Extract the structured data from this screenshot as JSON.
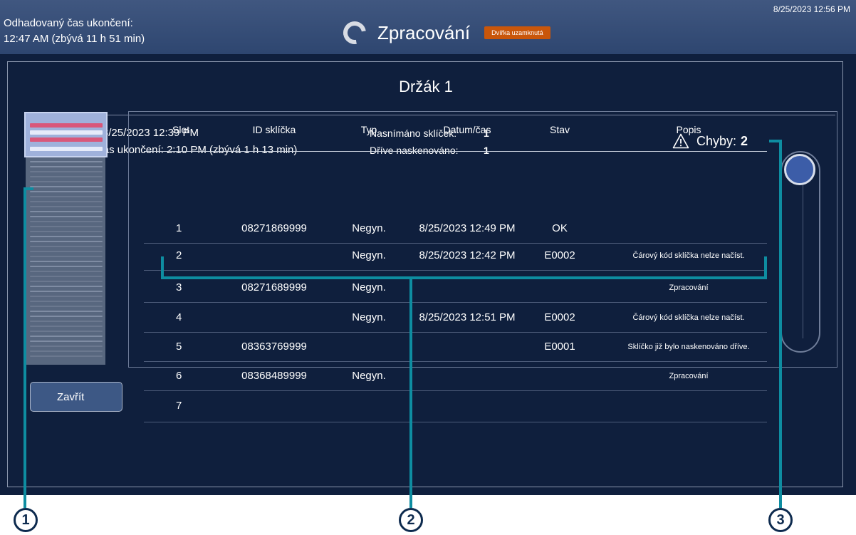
{
  "topbar": {
    "est_end_label": "Odhadovaný čas ukončení:",
    "est_end_value": "12:47 AM (zbývá 11 h 51 min)",
    "title": "Zpracování",
    "lock_badge": "Dvířka uzamknutá",
    "datetime": "8/25/2023 12:56 PM"
  },
  "holder": {
    "title": "Držák 1",
    "start_time": "Čas zahájení:  8/25/2023 12:39 PM",
    "est_end": "Odhadovaný čas ukončení:  2:10 PM (zbývá 1 h 13 min)",
    "scanned_label": "Nasnímáno sklíček:",
    "scanned_value": "1",
    "prev_label": "Dříve naskenováno:",
    "prev_value": "1",
    "errors_label": "Chyby:",
    "errors_value": "2"
  },
  "table": {
    "headers": [
      "Slot",
      "ID sklíčka",
      "Typ",
      "Datum/čas",
      "Stav",
      "Popis"
    ],
    "rows": [
      {
        "slot": "1",
        "id": "08271869999",
        "type": "Negyn.",
        "datetime": "8/25/2023 12:49 PM",
        "status": "OK",
        "desc": ""
      },
      {
        "slot": "2",
        "id": "",
        "type": "Negyn.",
        "datetime": "8/25/2023 12:42 PM",
        "status": "E0002",
        "desc": "Čárový kód sklíčka nelze načíst."
      },
      {
        "slot": "3",
        "id": "08271689999",
        "type": "Negyn.",
        "datetime": "",
        "status": "",
        "desc": "Zpracování"
      },
      {
        "slot": "4",
        "id": "",
        "type": "Negyn.",
        "datetime": "8/25/2023 12:51 PM",
        "status": "E0002",
        "desc": "Čárový kód sklíčka nelze načíst."
      },
      {
        "slot": "5",
        "id": "08363769999",
        "type": "",
        "datetime": "",
        "status": "E0001",
        "desc": "Sklíčko již bylo naskenováno dříve."
      },
      {
        "slot": "6",
        "id": "08368489999",
        "type": "Negyn.",
        "datetime": "",
        "status": "",
        "desc": "Zpracování"
      },
      {
        "slot": "7",
        "id": "",
        "type": "",
        "datetime": "",
        "status": "",
        "desc": ""
      }
    ]
  },
  "close_button": "Zavřít",
  "callouts": [
    "1",
    "2",
    "3"
  ],
  "colors": {
    "background": "#0f1f3d",
    "topbar": "#34496f",
    "badge": "#c9560a",
    "callout": "#0e8da1",
    "slide_error": "#d9577a",
    "slide_ok": "#e6ebfa"
  },
  "icons": {
    "spinner": "progress-spinner-icon",
    "warning": "warning-triangle-icon"
  }
}
